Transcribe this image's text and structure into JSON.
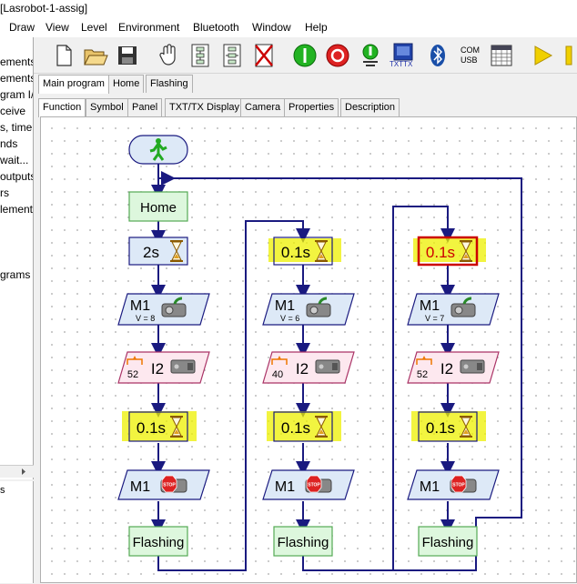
{
  "window": {
    "title": "[Lasrobot-1-assig]"
  },
  "menu": [
    "Draw",
    "View",
    "Level",
    "Environment",
    "Bluetooth",
    "Window",
    "Help"
  ],
  "toolbar_icons": [
    "new-file-icon",
    "open-folder-icon",
    "save-icon",
    "hand-cursor-icon",
    "download-program-icon",
    "upload-program-icon",
    "delete-icon",
    "start-icon",
    "stop-icon",
    "online-icon",
    "txtx-controller-icon",
    "bluetooth-icon",
    "com-usb-icon",
    "calculator-icon",
    "play-icon",
    "pause-icon"
  ],
  "toolbar_text": {
    "txtx": "TXTTX",
    "com": "COM",
    "usb": "USB"
  },
  "left_panel": [
    "ements",
    "ements",
    "gram I/",
    "ceive",
    "s, time",
    "nds",
    "wait...",
    "outputs",
    "rs",
    "lement",
    "grams"
  ],
  "tabs_main": [
    "Main program",
    "Home",
    "Flashing"
  ],
  "tabs_sub": [
    "Function",
    "Symbol",
    "Panel",
    "TXT/TX Display",
    "Camera",
    "Properties",
    "Description"
  ],
  "colors": {
    "block_green": "#ddf7dd",
    "block_blue": "#dde9f7",
    "block_pink": "#fde8ef",
    "highlight": "#eef000",
    "line": "#1a1a80",
    "selected": "#cc0000"
  },
  "flow": {
    "home_label": "Home",
    "col1": {
      "wait1": "2s",
      "motor_name": "M1",
      "motor_speed": "V = 8",
      "input_value": "52",
      "input_name": "I2",
      "wait2": "0.1s",
      "stop_name": "M1",
      "sub_label": "Flashing"
    },
    "col2": {
      "wait1": "0.1s",
      "motor_name": "M1",
      "motor_speed": "V = 6",
      "input_value": "40",
      "input_name": "I2",
      "wait2": "0.1s",
      "stop_name": "M1",
      "sub_label": "Flashing"
    },
    "col3": {
      "wait1": "0.1s",
      "motor_name": "M1",
      "motor_speed": "V = 7",
      "input_value": "52",
      "input_name": "I2",
      "wait2": "0.1s",
      "stop_name": "M1",
      "sub_label": "Flashing"
    },
    "stop_sign": "STOP"
  }
}
